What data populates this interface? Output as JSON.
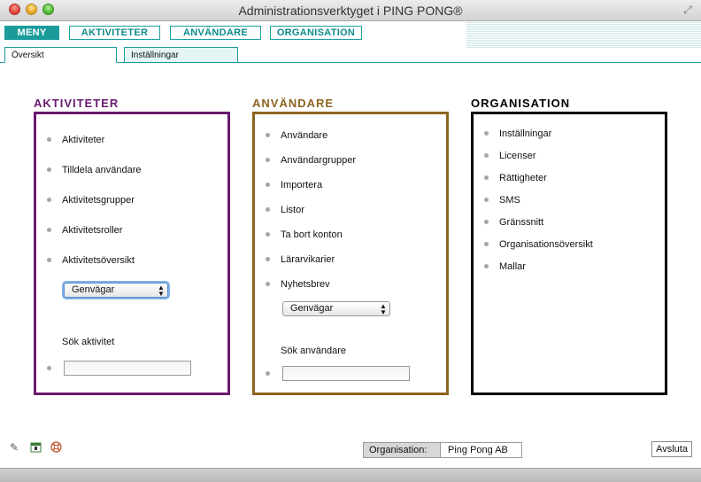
{
  "window": {
    "title": "Administrationsverktyget i PING PONG®"
  },
  "menu": {
    "items": [
      {
        "label": "MENY"
      },
      {
        "label": "AKTIVITETER"
      },
      {
        "label": "ANVÄNDARE"
      },
      {
        "label": "ORGANISATION"
      }
    ]
  },
  "tabs": [
    {
      "label": "Översikt"
    },
    {
      "label": "Inställningar"
    }
  ],
  "columns": {
    "aktiviteter": {
      "title": "AKTIVITETER",
      "color": "#6a1b6e",
      "items": [
        "Aktiviteter",
        "Tilldela användare",
        "Aktivitetsgrupper",
        "Aktivitetsroller",
        "Aktivitetsöversikt"
      ],
      "shortcut": "Genvägar",
      "search_label": "Sök aktivitet",
      "search_value": ""
    },
    "anvandare": {
      "title": "ANVÄNDARE",
      "color": "#8c6420",
      "items": [
        "Användare",
        "Användargrupper",
        "Importera",
        "Listor",
        "Ta bort konton",
        "Lärarvikarier",
        "Nyhetsbrev"
      ],
      "shortcut": "Genvägar",
      "search_label": "Sök användare",
      "search_value": ""
    },
    "organisation": {
      "title": "ORGANISATION",
      "color": "#000000",
      "items": [
        "Inställningar",
        "Licenser",
        "Rättigheter",
        "SMS",
        "Gränssnitt",
        "Organisationsöversikt",
        "Mallar"
      ]
    }
  },
  "footer": {
    "icons": [
      "pencil-icon",
      "calendar-icon",
      "lifebuoy-icon"
    ],
    "org_label": "Organisation:",
    "org_value": "Ping Pong AB",
    "quit_label": "Avsluta"
  }
}
